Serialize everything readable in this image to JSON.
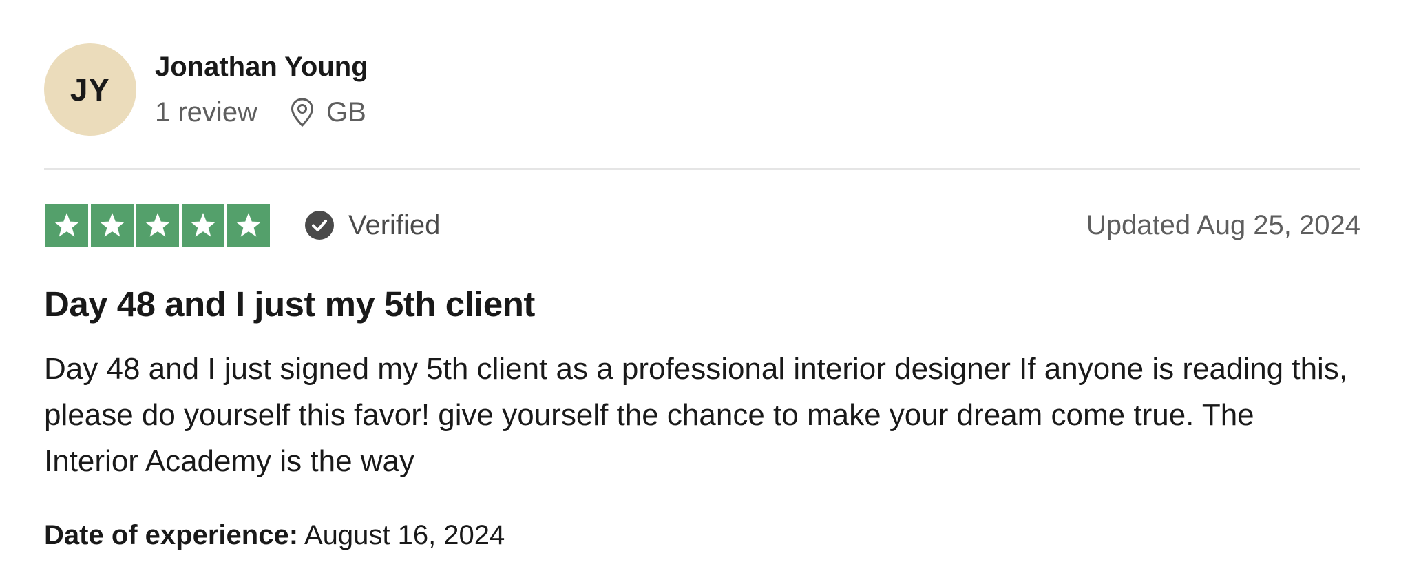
{
  "reviewer": {
    "initials": "JY",
    "avatar_color": "#ebdcbb",
    "name": "Jonathan Young",
    "review_count": "1 review",
    "location_icon": "location-pin-icon",
    "country": "GB"
  },
  "rating": {
    "stars": 5,
    "max_stars": 5,
    "star_color": "#54a06b",
    "verified_label": "Verified",
    "updated": "Updated Aug 25, 2024"
  },
  "review": {
    "title": "Day 48 and I just my 5th client",
    "body": "Day 48 and I just signed my 5th client as a professional interior designer If anyone is reading this, please do yourself this favor! give yourself the chance to make your dream come true. The Interior Academy is the way"
  },
  "experience": {
    "label": "Date of experience:",
    "date": "August 16, 2024"
  }
}
